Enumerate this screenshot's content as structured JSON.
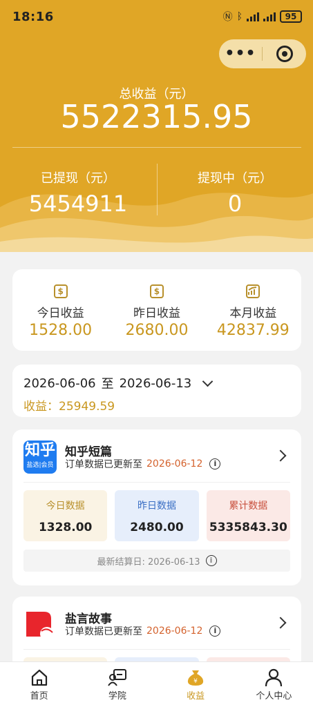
{
  "status": {
    "time": "18:16",
    "battery": "95"
  },
  "header": {
    "total_label": "总收益（元）",
    "total_value": "5522315.95",
    "withdrawn_label": "已提现（元）",
    "withdrawn_value": "5454911",
    "pending_label": "提现中（元）",
    "pending_value": "0",
    "capsule_more": "•••"
  },
  "stats": [
    {
      "label": "今日收益",
      "value": "1528.00",
      "icon": "$"
    },
    {
      "label": "昨日收益",
      "value": "2680.00",
      "icon": "$"
    },
    {
      "label": "本月收益",
      "value": "42837.99",
      "icon": "chart"
    }
  ],
  "range": {
    "start": "2026-06-06",
    "sep": "至",
    "end": "2026-06-13",
    "income": "收益：25949.59"
  },
  "apps": [
    {
      "name": "知乎短篇",
      "logo_big": "知乎",
      "logo_small": "盐选|会员",
      "update_prefix": "订单数据已更新至",
      "update_date": "2026-06-12",
      "boxes": [
        {
          "label": "今日数据",
          "value": "1328.00"
        },
        {
          "label": "昨日数据",
          "value": "2480.00"
        },
        {
          "label": "累计数据",
          "value": "5335843.30"
        }
      ],
      "settle": "最新结算日:  2026-06-13"
    },
    {
      "name": "盐言故事",
      "update_prefix": "订单数据已更新至",
      "update_date": "2026-06-12"
    }
  ],
  "tabs": [
    {
      "label": "首页",
      "icon": "home-icon"
    },
    {
      "label": "学院",
      "icon": "academy-icon"
    },
    {
      "label": "收益",
      "icon": "money-bag-icon",
      "active": true
    },
    {
      "label": "个人中心",
      "icon": "person-icon"
    }
  ],
  "colors": {
    "header": "#e0a626",
    "accent": "#c9971f",
    "date": "#d4622d"
  }
}
